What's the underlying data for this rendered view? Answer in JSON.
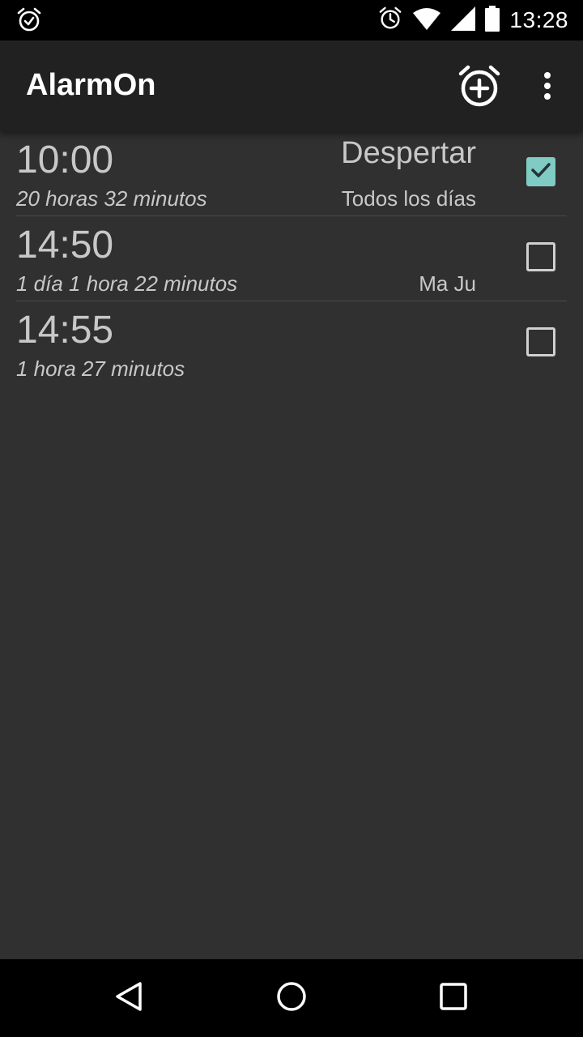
{
  "status_bar": {
    "time": "13:28",
    "icons": [
      "alarm-check-icon",
      "alarm-icon",
      "wifi-icon",
      "signal-icon",
      "battery-icon"
    ]
  },
  "app_bar": {
    "title": "AlarmOn",
    "actions": [
      "add-alarm-icon",
      "overflow-menu-icon"
    ]
  },
  "alarms": [
    {
      "time": "10:00",
      "remaining": "20 horas 32 minutos",
      "label": "Despertar",
      "repeat": "Todos los días",
      "enabled": true
    },
    {
      "time": "14:50",
      "remaining": "1 día 1 hora 22 minutos",
      "label": "",
      "repeat": "Ma Ju",
      "enabled": false
    },
    {
      "time": "14:55",
      "remaining": "1 hora 27 minutos",
      "label": "",
      "repeat": "",
      "enabled": false
    }
  ],
  "nav_bar": {
    "buttons": [
      "back-icon",
      "home-icon",
      "recents-icon"
    ]
  },
  "colors": {
    "background": "#303030",
    "app_bar": "#212121",
    "accent": "#80cbc4",
    "text": "#c8c8c8"
  }
}
